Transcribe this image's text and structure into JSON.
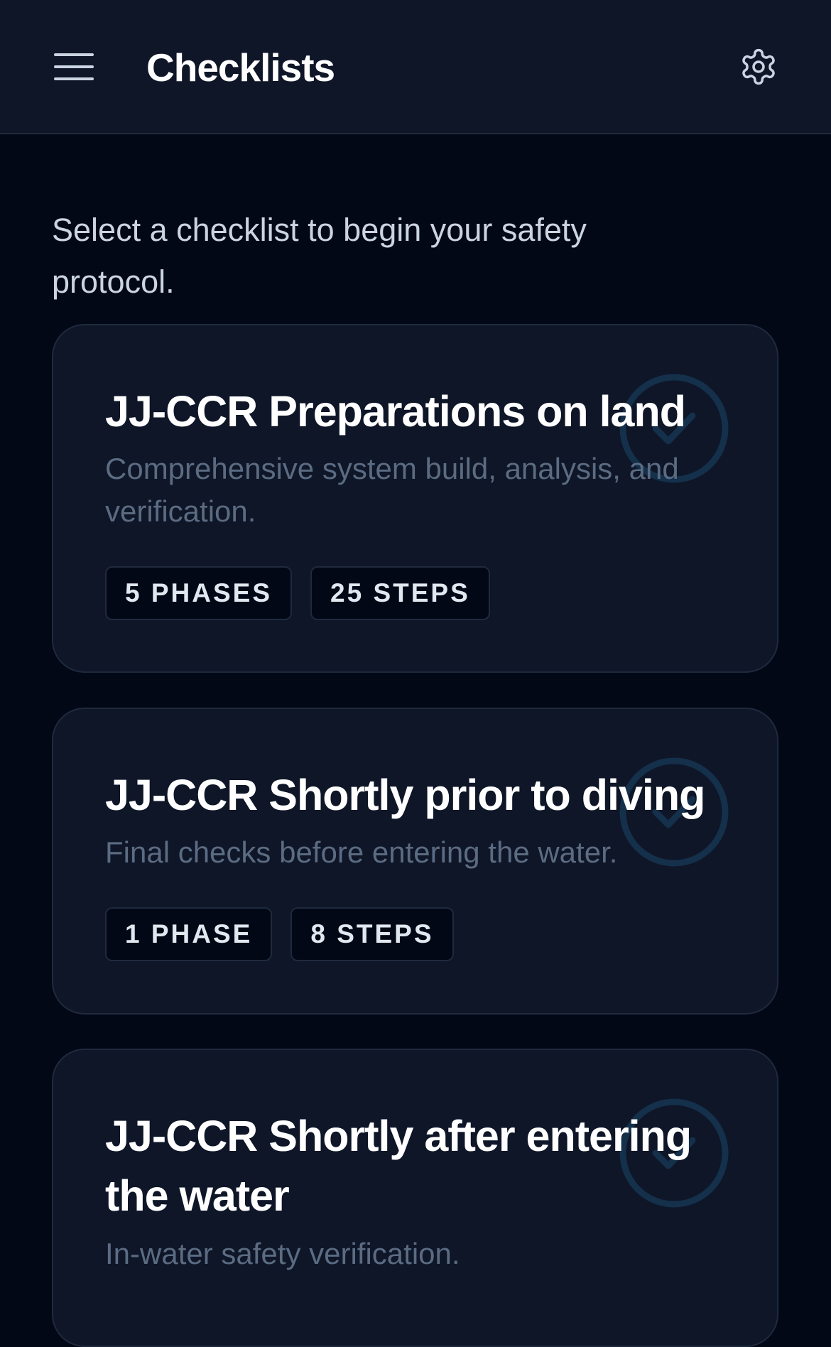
{
  "header": {
    "title": "Checklists",
    "menu_icon": "hamburger-menu-icon",
    "settings_icon": "gear-icon"
  },
  "intro": "Select a checklist to begin your safety protocol.",
  "checklists": [
    {
      "title": "JJ-CCR Preparations on land",
      "description": "Comprehensive system build, analysis, and verification.",
      "phases": "5 PHASES",
      "steps": "25 STEPS"
    },
    {
      "title": "JJ-CCR Shortly prior to diving",
      "description": "Final checks before entering the water.",
      "phases": "1 PHASE",
      "steps": "8 STEPS"
    },
    {
      "title": "JJ-CCR Shortly after entering the water",
      "description": "In-water safety verification."
    }
  ],
  "colors": {
    "background": "#030817",
    "surface": "#0e1628",
    "border": "#1f2a3d",
    "muted_text": "#5b6b82",
    "check_accent": "#14304b"
  }
}
